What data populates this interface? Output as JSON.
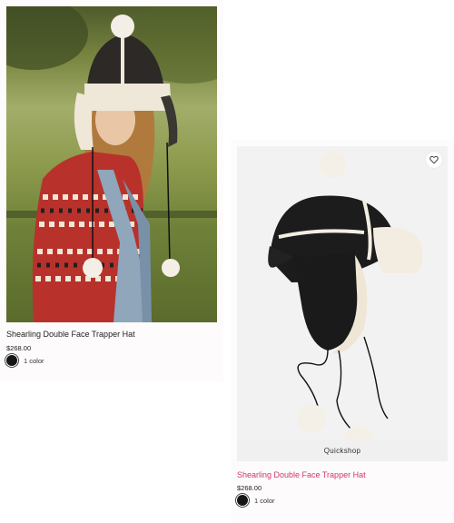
{
  "products": [
    {
      "name": "Shearling Double Face Trapper Hat",
      "price": "$268.00",
      "color_count": "1 color",
      "swatch_color": "#151515"
    },
    {
      "name": "Shearling Double Face Trapper Hat",
      "price": "$268.00",
      "color_count": "1 color",
      "swatch_color": "#151515",
      "quickshop_label": "Quickshop",
      "wishlist_icon": "heart-icon"
    }
  ],
  "colors": {
    "link_pink": "#d6336c",
    "text": "#222222"
  }
}
